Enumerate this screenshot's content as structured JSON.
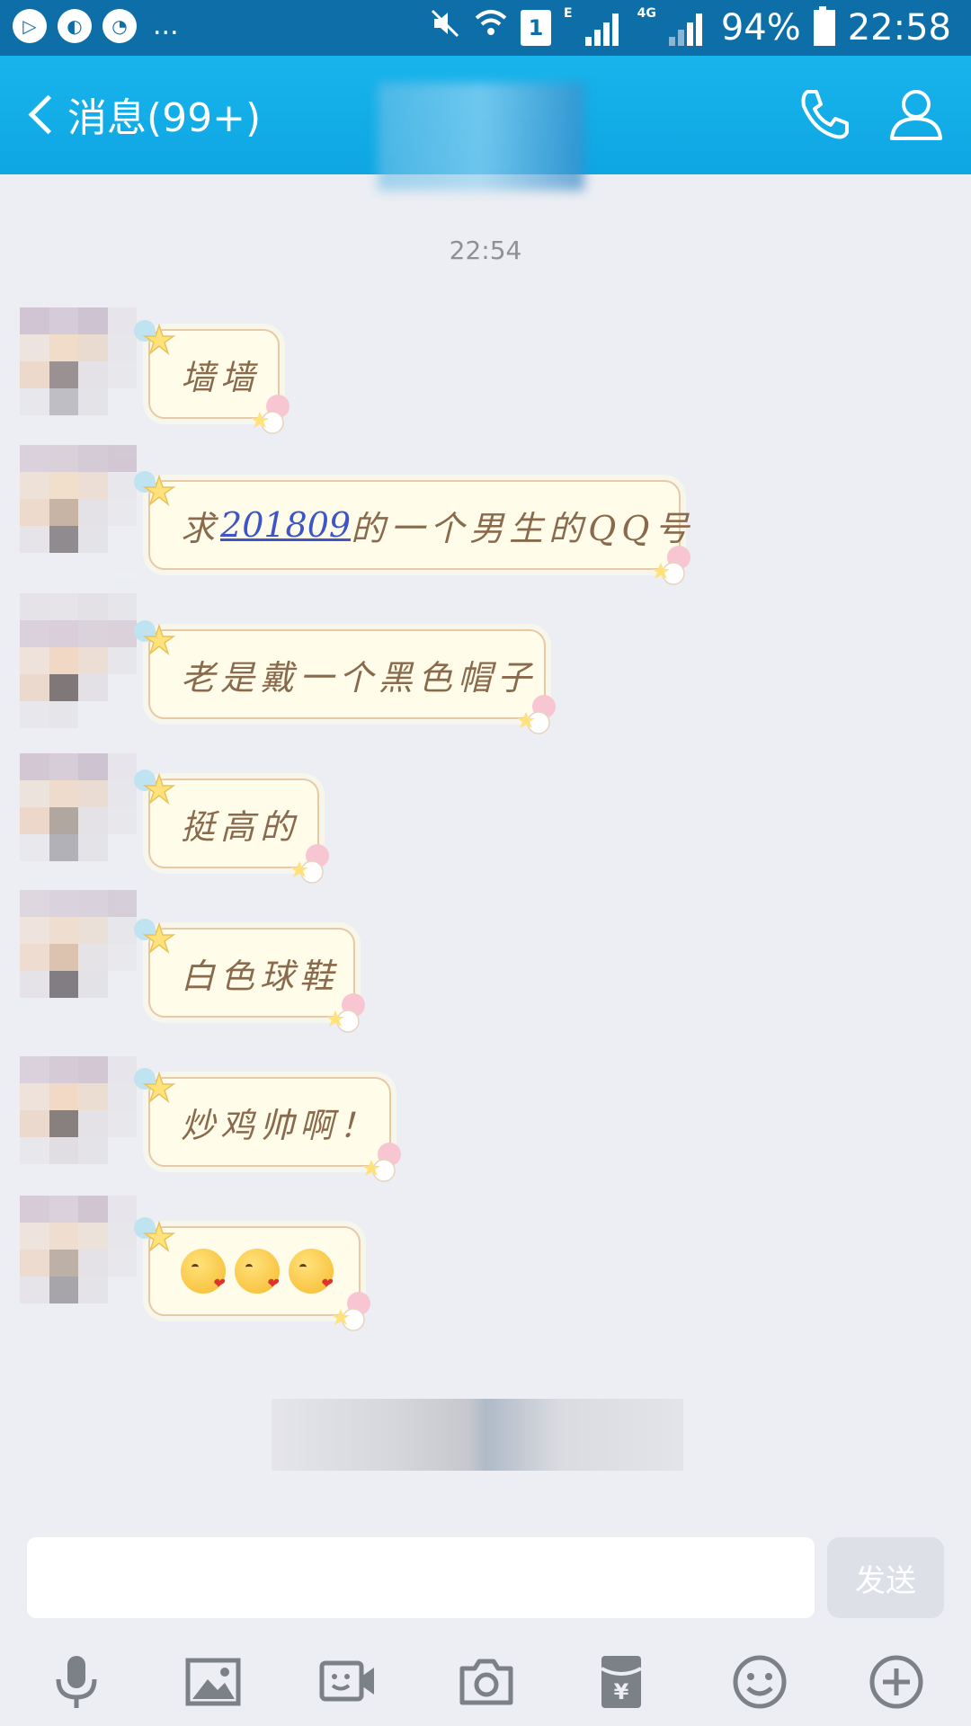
{
  "status_bar": {
    "more_indicator": "...",
    "sim_slot": "1",
    "network_e": "E",
    "network_4g": "4G",
    "battery_percent": "94%",
    "time": "22:58"
  },
  "header": {
    "back_label": "消息(99+)"
  },
  "chat": {
    "timestamp": "22:54",
    "messages": [
      {
        "text": "墙墙"
      },
      {
        "prefix": "求",
        "link": "201809",
        "suffix": "的一个男生的QQ号"
      },
      {
        "text": "老是戴一个黑色帽子"
      },
      {
        "text": "挺高的"
      },
      {
        "text": "白色球鞋"
      },
      {
        "text": "炒鸡帅啊！"
      },
      {
        "emoji": [
          "face-blowing-kiss",
          "face-blowing-kiss",
          "face-blowing-kiss"
        ]
      }
    ]
  },
  "composer": {
    "input_value": "",
    "send_label": "发送"
  },
  "toolbar": {
    "icons": [
      "microphone-icon",
      "image-icon",
      "video-call-icon",
      "camera-icon",
      "red-packet-icon",
      "emoji-icon",
      "plus-icon"
    ]
  },
  "colors": {
    "status_bar": "#0e6fa8",
    "title_bar": "#14aee8",
    "chat_bg": "#eceef3",
    "bubble_bg": "#fffce9",
    "bubble_text": "#8a6a4c",
    "link": "#3d55c6"
  }
}
